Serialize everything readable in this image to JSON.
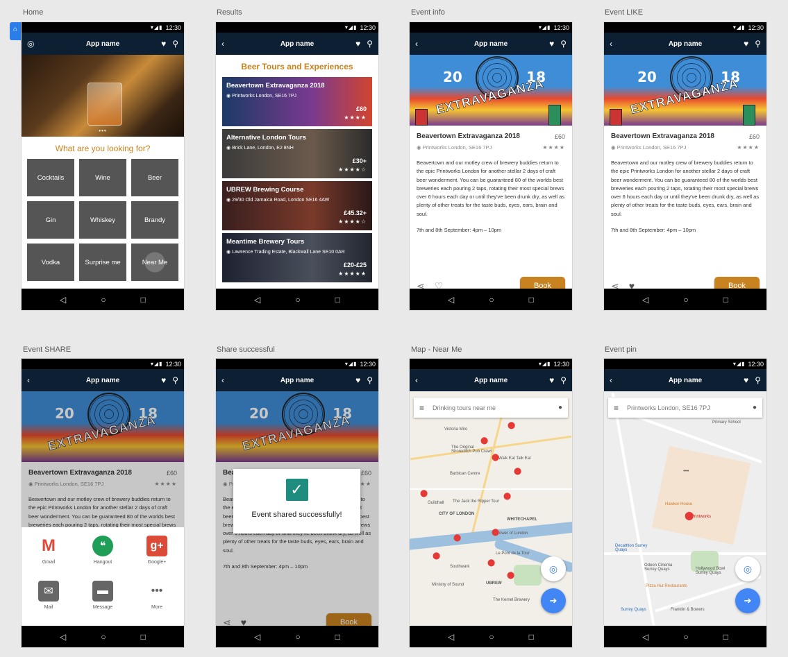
{
  "captions": [
    "Home",
    "Results",
    "Event info",
    "Event LIKE",
    "Event SHARE",
    "Share successful",
    "Map - Near Me",
    "Event pin"
  ],
  "statusbar": {
    "time": "12:30"
  },
  "appbar": {
    "title": "App name"
  },
  "home": {
    "question": "What are you looking for?",
    "carousel_dots": "•••",
    "categories": [
      "Cocktails",
      "Wine",
      "Beer",
      "Gin",
      "Whiskey",
      "Brandy",
      "Vodka",
      "Surprise me",
      "Near Me"
    ]
  },
  "results": {
    "heading": "Beer Tours and Experiences",
    "items": [
      {
        "name": "Beavertown Extravaganza 2018",
        "address": "Printworks London, SE16 7PJ",
        "price": "£60",
        "stars": "★★★★"
      },
      {
        "name": "Alternative London Tours",
        "address": "Brick Lane, London, E2 8NH",
        "price": "£30+",
        "stars": "★★★★☆"
      },
      {
        "name": "UBREW Brewing Course",
        "address": "29/30 Old Jamaica Road, London SE16 4AW",
        "price": "£45.32+",
        "stars": "★★★★☆"
      },
      {
        "name": "Meantime Brewery Tours",
        "address": "Lawrence Trading Estate, Blackwall Lane SE10 0AR",
        "price": "£20-£25",
        "stars": "★★★★★"
      }
    ]
  },
  "event": {
    "title": "Beavertown Extravaganza 2018",
    "price": "£60",
    "address": "Printworks London, SE16 7PJ",
    "stars": "★★★★",
    "description": "Beavertown and our motley crew of brewery buddies return to the epic Printworks London for another stellar 2 days of craft beer wonderment. You can be guaranteed 80 of the worlds best breweries each pouring 2 taps, rotating their most special brews over 6 hours each day or until they've been drunk dry, as well as plenty of other treats for the taste buds, eyes, ears, brain and soul.",
    "date": "7th and 8th September: 4pm – 10pm",
    "book_label": "Book",
    "poster": {
      "year_left": "20",
      "year_right": "18",
      "word": "EXTRAVAGANZA"
    }
  },
  "share": {
    "apps": [
      {
        "label": "Gmail",
        "icon": "gmail-icon",
        "glyph": "M",
        "color": "#e04a3a"
      },
      {
        "label": "Hangout",
        "icon": "hangouts-icon",
        "glyph": "❝",
        "color": "#1e9e57"
      },
      {
        "label": "Google+",
        "icon": "google-plus-icon",
        "glyph": "g+",
        "color": "#dc4a38"
      },
      {
        "label": "Mail",
        "icon": "mail-icon",
        "glyph": "✉",
        "color": "#666666"
      },
      {
        "label": "Message",
        "icon": "message-icon",
        "glyph": "▬",
        "color": "#666666"
      },
      {
        "label": "More",
        "icon": "more-icon",
        "glyph": "•••",
        "color": "#ffffff"
      }
    ],
    "success_message": "Event shared successfully!"
  },
  "map_near": {
    "search_placeholder": "Drinking tours near me",
    "labels": [
      "Victoria Miro",
      "The Original Shoreditch Pub Crawl",
      "Walk Eat Talk Eat",
      "Barbican Centre",
      "Guildhall",
      "The Jack the Ripper Tour",
      "CITY OF LONDON",
      "WHITECHAPEL",
      "Tower of London",
      "Le Pont de la Tour",
      "Southwark",
      "Ministry of Sound",
      "UBREW",
      "The Kernel Brewery"
    ]
  },
  "map_pin": {
    "search_value": "Printworks London, SE16 7PJ",
    "labels": [
      "Hawker House",
      "Printworks",
      "Decathlon Surrey Quays",
      "Odeon Cinema Surrey Quays",
      "Hollywood Bowl Surrey Quays",
      "Pizza Hut Restaurants",
      "Surrey Quays",
      "Franklin & Bowers",
      "Primary School"
    ]
  },
  "colors": {
    "accent": "#c8821f",
    "appbar": "#0d1f33",
    "fab": "#4285f4"
  }
}
